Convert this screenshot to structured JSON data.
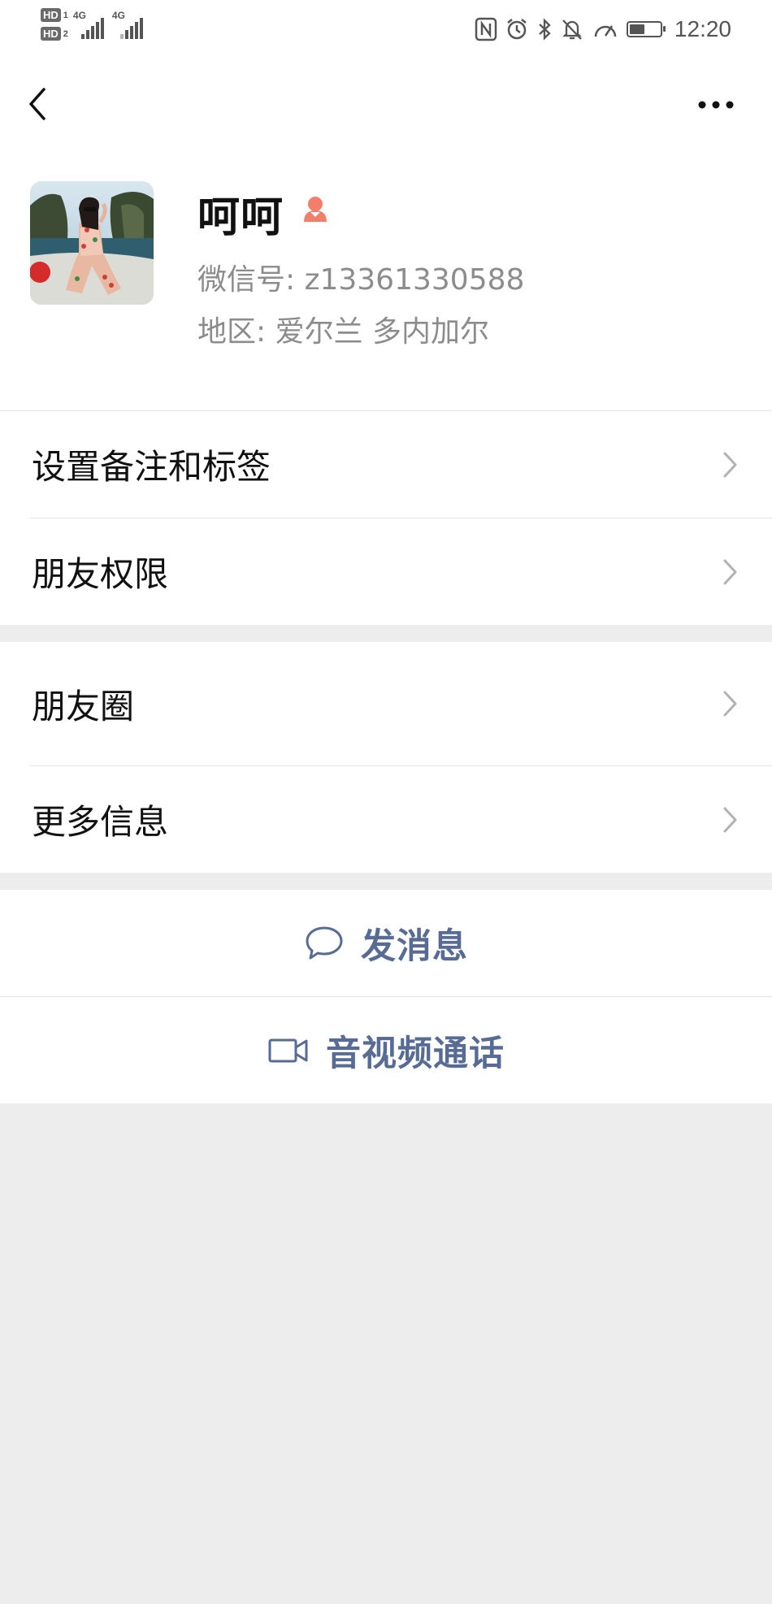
{
  "status_bar": {
    "hd1": "HD",
    "hd1_num": "1",
    "hd2": "HD",
    "hd2_num": "2",
    "net1": "4G",
    "net2": "4G",
    "time": "12:20",
    "battery_level": 0.45,
    "icons": [
      "nfc-icon",
      "alarm-icon",
      "bluetooth-icon",
      "mute-icon",
      "speed-icon",
      "battery-icon"
    ]
  },
  "profile": {
    "name": "呵呵",
    "gender_icon": "female-icon",
    "gender_color": "#f37e6b",
    "wechat_id": "微信号: z13361330588",
    "region": "地区: 爱尔兰  多内加尔"
  },
  "menu_groups": [
    {
      "items": [
        "设置备注和标签",
        "朋友权限"
      ]
    },
    {
      "items": [
        "朋友圈",
        "更多信息"
      ]
    }
  ],
  "actions": {
    "message": "发消息",
    "call": "音视频通话"
  },
  "colors": {
    "accent": "#576b95",
    "background": "#ededed",
    "secondary_text": "#8c8c8c"
  }
}
